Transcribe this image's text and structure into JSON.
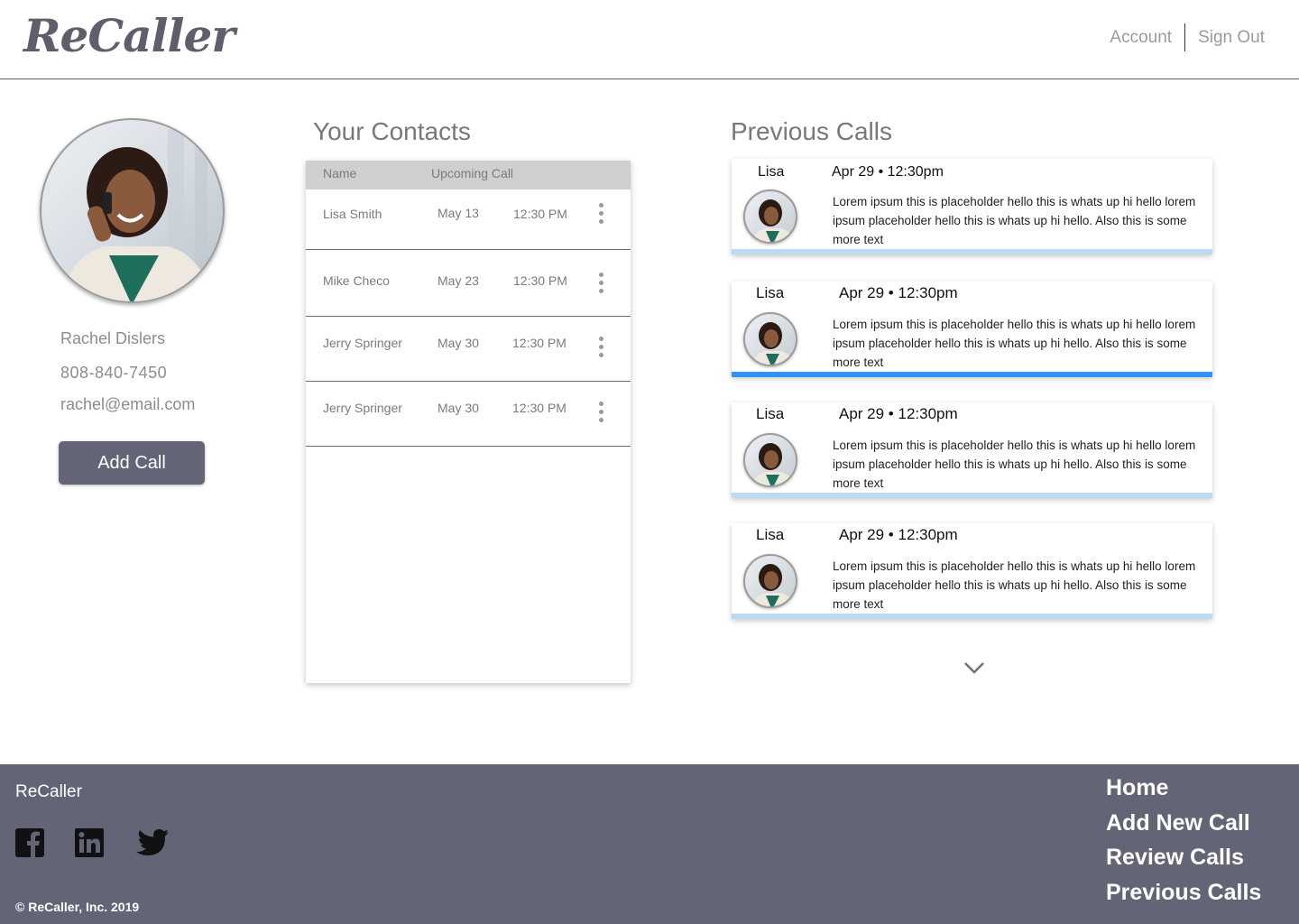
{
  "header": {
    "logo": "ReCaller",
    "nav": {
      "account": "Account",
      "sign_out": "Sign Out"
    }
  },
  "profile": {
    "name": "Rachel Dislers",
    "phone": "808-840-7450",
    "email": "rachel@email.com",
    "add_call_label": "Add Call"
  },
  "contacts": {
    "title": "Your Contacts",
    "headers": {
      "name": "Name",
      "upcoming": "Upcoming Call"
    },
    "rows": [
      {
        "name": "Lisa Smith",
        "date": "May 13",
        "time": "12:30 PM"
      },
      {
        "name": "Mike Checo",
        "date": "May 23",
        "time": "12:30 PM"
      },
      {
        "name": "Jerry Springer",
        "date": "May 30",
        "time": "12:30 PM"
      },
      {
        "name": "Jerry Springer",
        "date": "May 30",
        "time": "12:30 PM"
      }
    ]
  },
  "previous_calls": {
    "title": "Previous Calls",
    "items": [
      {
        "name": "Lisa",
        "datetime": "Apr 29 • 12:30pm",
        "text": "Lorem ipsum this is placeholder hello this is whats up hi hello lorem ipsum  placeholder hello this is whats up hi hello. Also this is some more text"
      },
      {
        "name": "Lisa",
        "datetime": "Apr 29 • 12:30pm",
        "text": "Lorem ipsum this is placeholder hello this is whats up hi hello lorem ipsum  placeholder hello this is whats up hi hello. Also this is some more text"
      },
      {
        "name": "Lisa",
        "datetime": "Apr 29 • 12:30pm",
        "text": "Lorem ipsum this is placeholder hello this is whats up hi hello lorem ipsum  placeholder hello this is whats up hi hello. Also this is some more text"
      },
      {
        "name": "Lisa",
        "datetime": "Apr 29 • 12:30pm",
        "text": "Lorem ipsum this is placeholder hello this is whats up hi hello lorem ipsum  placeholder hello this is whats up hi hello. Also this is some more text"
      }
    ]
  },
  "footer": {
    "brand": "ReCaller",
    "social": [
      "facebook-icon",
      "linkedin-icon",
      "twitter-icon"
    ],
    "copyright": "© ReCaller, Inc. 2019",
    "links": {
      "home": "Home",
      "add_new_call": "Add New Call",
      "review_calls": "Review Calls",
      "previous_calls": "Previous Calls"
    }
  },
  "colors": {
    "footer_bg": "#636577",
    "button_bg": "#636577",
    "active_bar": "#2f94f0",
    "inactive_bar": "#bcd9f5"
  }
}
